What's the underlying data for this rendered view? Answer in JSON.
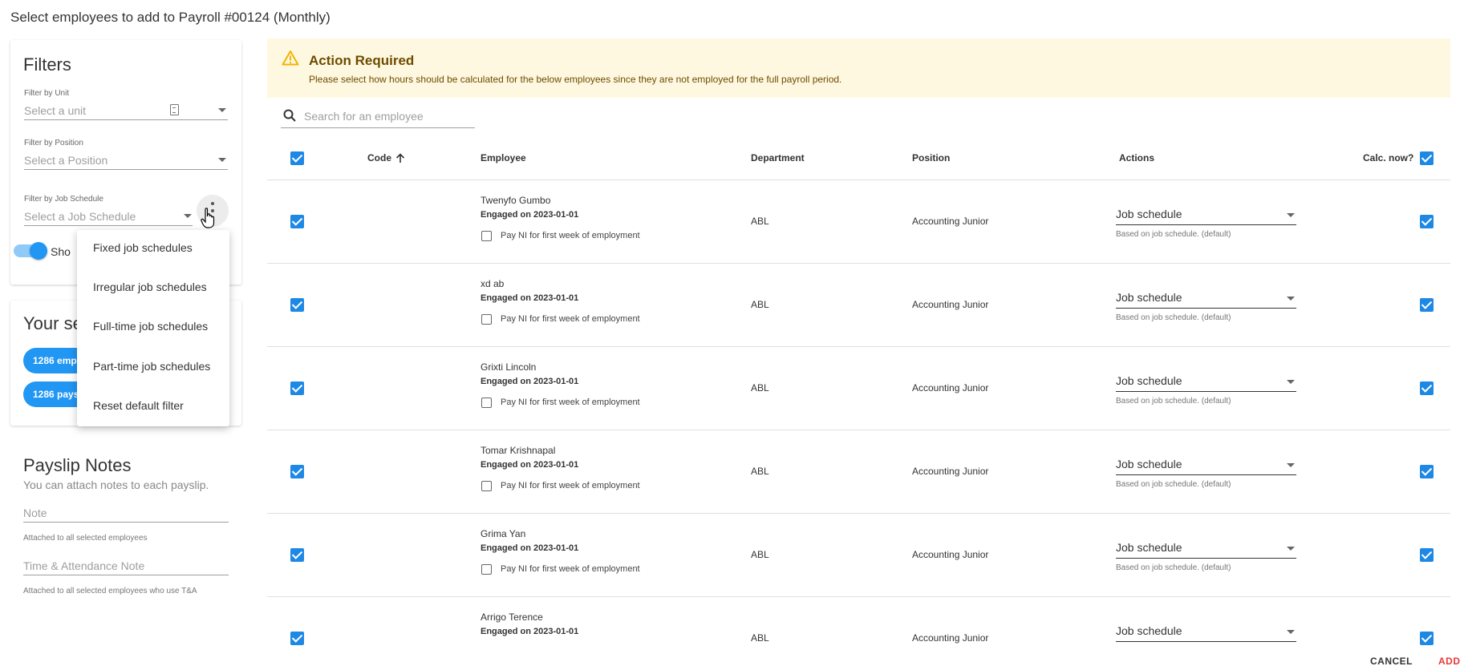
{
  "title": "Select employees to add to Payroll #00124 (Monthly)",
  "filters": {
    "title": "Filters",
    "unit_label": "Filter by Unit",
    "unit_placeholder": "Select a unit",
    "position_label": "Filter by Position",
    "position_placeholder": "Select a Position",
    "schedule_label": "Filter by Job Schedule",
    "schedule_placeholder": "Select a Job Schedule",
    "toggle_label": "Sho",
    "toggle_on": true
  },
  "selection": {
    "title": "Your se",
    "chips": [
      "1286 empl",
      "1286 paysl"
    ]
  },
  "notes": {
    "title": "Payslip Notes",
    "subtitle": "You can attach notes to each payslip.",
    "note_placeholder": "Note",
    "note_hint": "Attached to all selected employees",
    "ta_placeholder": "Time & Attendance Note",
    "ta_hint": "Attached to all selected employees who use T&A"
  },
  "menu": {
    "items": [
      "Fixed job schedules",
      "Irregular job schedules",
      "Full-time job schedules",
      "Part-time job schedules",
      "Reset default filter"
    ]
  },
  "alert": {
    "title": "Action Required",
    "message": "Please select how hours should be calculated for the below employees since they are not employed for the full payroll period.",
    "color": "#fff8e1"
  },
  "search": {
    "placeholder": "Search for an employee"
  },
  "table": {
    "headers": {
      "code": "Code",
      "employee": "Employee",
      "department": "Department",
      "position": "Position",
      "actions": "Actions",
      "calc_now": "Calc. now?"
    },
    "rows": [
      {
        "name": "Twenyfo Gumbo",
        "engaged": "Engaged on 2023-01-01",
        "pay_ni": "Pay NI for first week of employment",
        "department": "ABL",
        "position": "Accounting Junior",
        "action": "Job schedule",
        "hint": "Based on job schedule. (default)"
      },
      {
        "name": "xd ab",
        "engaged": "Engaged on 2023-01-01",
        "pay_ni": "Pay NI for first week of employment",
        "department": "ABL",
        "position": "Accounting Junior",
        "action": "Job schedule",
        "hint": "Based on job schedule. (default)"
      },
      {
        "name": "Grixti Lincoln",
        "engaged": "Engaged on 2023-01-01",
        "pay_ni": "Pay NI for first week of employment",
        "department": "ABL",
        "position": "Accounting Junior",
        "action": "Job schedule",
        "hint": "Based on job schedule. (default)"
      },
      {
        "name": "Tomar Krishnapal",
        "engaged": "Engaged on 2023-01-01",
        "pay_ni": "Pay NI for first week of employment",
        "department": "ABL",
        "position": "Accounting Junior",
        "action": "Job schedule",
        "hint": "Based on job schedule. (default)"
      },
      {
        "name": "Grima Yan",
        "engaged": "Engaged on 2023-01-01",
        "pay_ni": "Pay NI for first week of employment",
        "department": "ABL",
        "position": "Accounting Junior",
        "action": "Job schedule",
        "hint": "Based on job schedule. (default)"
      },
      {
        "name": "Arrigo Terence",
        "engaged": "Engaged on 2023-01-01",
        "pay_ni": "",
        "department": "ABL",
        "position": "Accounting Junior",
        "action": "Job schedule",
        "hint": ""
      }
    ]
  },
  "footer": {
    "cancel": "CANCEL",
    "add": "ADD",
    "cancel_color": "#333333",
    "add_color": "#e53935"
  },
  "colors": {
    "accent": "#1e88e5",
    "chip": "#2196f3"
  }
}
